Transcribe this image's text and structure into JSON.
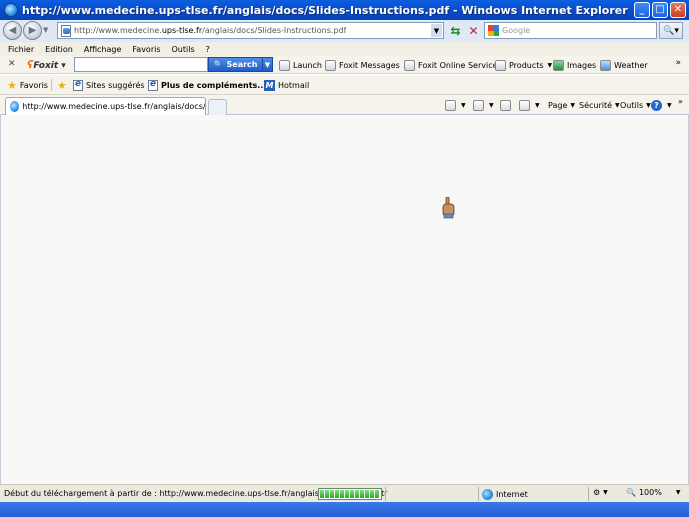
{
  "window": {
    "title": "http://www.medecine.ups-tlse.fr/anglais/docs/Slides-Instructions.pdf - Windows Internet Explorer",
    "minimize": "_",
    "maximize": "□",
    "close": "✕"
  },
  "address": {
    "url_prefix": "http://www.medecine.",
    "url_domain": "ups-tlse.fr",
    "url_path": "/anglais/docs/Slides-Instructions.pdf",
    "search_placeholder": "Google"
  },
  "menu": [
    "Fichier",
    "Edition",
    "Affichage",
    "Favoris",
    "Outils",
    "?"
  ],
  "foxit": {
    "brand": "Foxit",
    "search_label": "Search",
    "items": [
      {
        "label": "Launch",
        "has_dropdown": false
      },
      {
        "label": "Foxit Messages",
        "has_dropdown": true
      },
      {
        "label": "Foxit Online Services",
        "has_dropdown": false
      },
      {
        "label": "Products",
        "has_dropdown": true
      },
      {
        "label": "Images",
        "has_dropdown": false
      },
      {
        "label": "Weather",
        "has_dropdown": false
      }
    ],
    "more": "»"
  },
  "favorites": {
    "favorites_label": "Favoris",
    "suggested_label": "Sites suggérés",
    "addons_label": "Plus de compléments...",
    "hotmail_label": "Hotmail"
  },
  "tabs": {
    "active_title": "http://www.medecine.ups-tlse.fr/anglais/docs/Slides-...",
    "commands": {
      "page": "Page",
      "security": "Sécurité",
      "tools": "Outils"
    },
    "more": "»"
  },
  "status": {
    "text": "Début du téléchargement à partir de : http://www.medecine.ups-tlse.fr/anglais/docs/Slides-Instr",
    "progress_segments": 12,
    "zone": "Internet",
    "zoom": "100%"
  },
  "colors": {
    "titlebar": "#0b4fd0",
    "content_bg": "#f8f8f6",
    "progress": "#2aa82a"
  }
}
